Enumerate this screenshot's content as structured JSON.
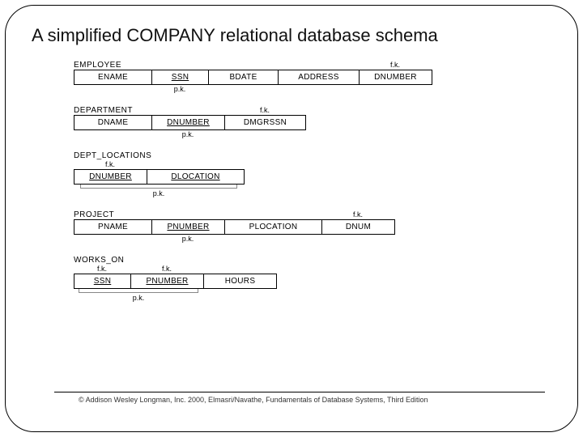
{
  "title": "A simplified COMPANY relational database schema",
  "footer": "© Addison Wesley Longman, Inc. 2000, Elmasri/Navathe, Fundamentals of Database Systems, Third Edition",
  "relations": {
    "employee": {
      "name": "EMPLOYEE",
      "fk_over": "DNUMBER",
      "fk_label": "f.k.",
      "attrs": [
        "ENAME",
        "SSN",
        "BDATE",
        "ADDRESS",
        "DNUMBER"
      ],
      "pk_under": "SSN",
      "pk_label": "p.k."
    },
    "department": {
      "name": "DEPARTMENT",
      "fk_over": "DMGRSSN",
      "fk_label": "f.k.",
      "attrs": [
        "DNAME",
        "DNUMBER",
        "DMGRSSN"
      ],
      "pk_under": "DNUMBER",
      "pk_label": "p.k."
    },
    "dept_locations": {
      "name": "DEPT_LOCATIONS",
      "fk_over": "DNUMBER",
      "fk_label": "f.k.",
      "attrs": [
        "DNUMBER",
        "DLOCATION"
      ],
      "pk_under_span": [
        "DNUMBER",
        "DLOCATION"
      ],
      "pk_label": "p.k."
    },
    "project": {
      "name": "PROJECT",
      "fk_over": "DNUM",
      "fk_label": "f.k.",
      "attrs": [
        "PNAME",
        "PNUMBER",
        "PLOCATION",
        "DNUM"
      ],
      "pk_under": "PNUMBER",
      "pk_label": "p.k."
    },
    "works_on": {
      "name": "WORKS_ON",
      "fk_over_multi": {
        "SSN": "f.k.",
        "PNUMBER": "f.k."
      },
      "attrs": [
        "SSN",
        "PNUMBER",
        "HOURS"
      ],
      "pk_under_span": [
        "SSN",
        "PNUMBER"
      ],
      "pk_label": "p.k."
    }
  },
  "widths": {
    "ENAME": 96,
    "SSN": 70,
    "BDATE": 86,
    "ADDRESS": 100,
    "DNUMBER": 90,
    "DNAME": 96,
    "DMGRSSN": 100,
    "DLOCATION": 120,
    "PNAME": 96,
    "PNUMBER": 90,
    "PLOCATION": 120,
    "DNUM": 90,
    "HOURS": 90
  }
}
